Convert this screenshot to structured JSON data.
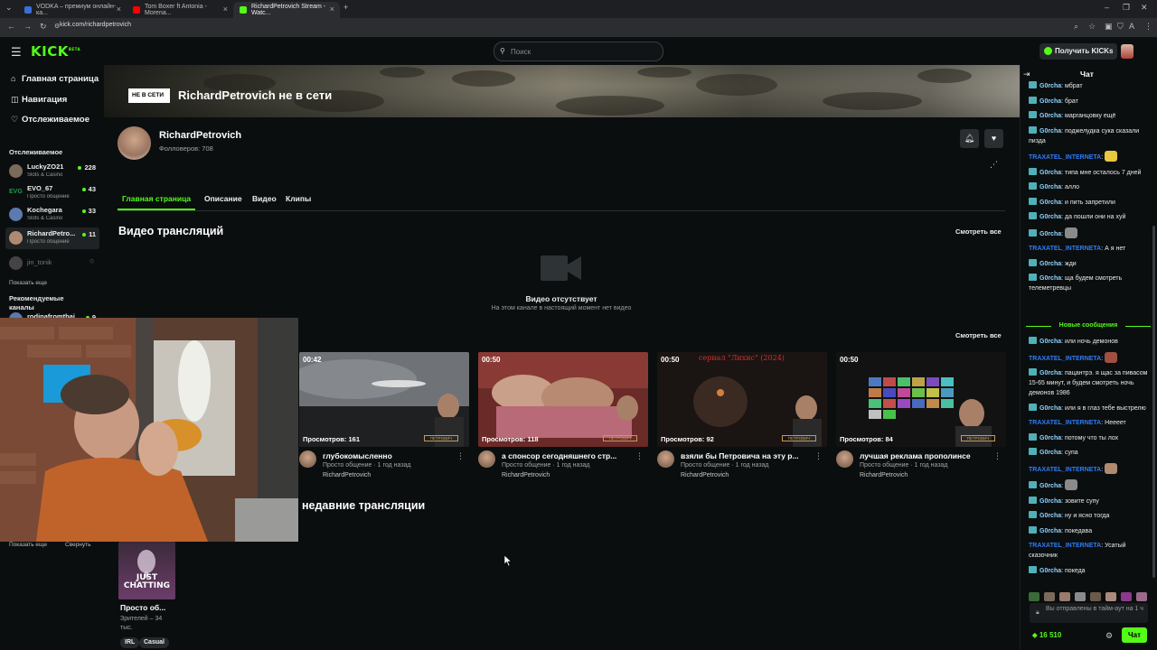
{
  "browser": {
    "tabs": [
      {
        "label": "VODKA – премиум онлайн-ка...",
        "favicon_color": "#3b6fd8"
      },
      {
        "label": "Tom Boxer ft Antonia - Morena...",
        "favicon_color": "#ff0000"
      },
      {
        "label": "RichardPetrovich Stream - Watc...",
        "favicon_color": "#53fc18"
      }
    ],
    "url": "kick.com/richardpetrovich"
  },
  "topnav": {
    "logo": "KICK",
    "logo_beta": "BETA",
    "search_placeholder": "Поиск",
    "get_kicks": "Получить KICKs"
  },
  "sidebar": {
    "nav": [
      {
        "label": "Главная страница",
        "icon": "home-icon"
      },
      {
        "label": "Навигация",
        "icon": "compass-icon"
      },
      {
        "label": "Отслеживаемое",
        "icon": "heart-icon"
      }
    ],
    "following_title": "Отслеживаемое",
    "following": [
      {
        "name": "LuckyZO21",
        "category": "Slots & Casino",
        "viewers": "228",
        "color": "#7a6a5a"
      },
      {
        "name": "EVO_67",
        "category": "Просто общение",
        "viewers": "43",
        "color": "#1c7a3c"
      },
      {
        "name": "Kochegara",
        "category": "Slots & Casino",
        "viewers": "33",
        "color": "#5a7ab0"
      },
      {
        "name": "RichardPetro...",
        "category": "Просто общение",
        "viewers": "11",
        "color": "#b08a70"
      },
      {
        "name": "jin_tonik",
        "category": "",
        "viewers": "",
        "color": "#444"
      }
    ],
    "show_more": "Показать еще",
    "recommended_title": "Рекомендуемые каналы",
    "recommended_first": "rodinafromthai",
    "recommended_count": "9",
    "bottom_show_more": "Показать еще",
    "collapse": "Свернуть"
  },
  "channel": {
    "offline_badge": "НЕ В СЕТИ",
    "offline_title": "RichardPetrovich не в сети",
    "name": "RichardPetrovich",
    "followers": "Фолловеров: 708",
    "tabs": [
      "Главная страница",
      "Описание",
      "Видео",
      "Клипы"
    ],
    "active_tab": 0
  },
  "videos": {
    "title": "Видео трансляций",
    "see_all": "Смотреть все",
    "empty_title": "Видео отсутствует",
    "empty_sub": "На этом канале в настоящий момент нет видео"
  },
  "clips": {
    "see_all": "Смотреть все",
    "items": [
      {
        "duration": "00:42",
        "views": "Просмотров: 161",
        "title": "глубокомысленно",
        "meta": "Просто общение · 1 год назад",
        "author": "RichardPetrovich"
      },
      {
        "duration": "00:50",
        "views": "Просмотров: 118",
        "title": "а спонсор сегодняшнего стр...",
        "meta": "Просто общение · 1 год назад",
        "author": "RichardPetrovich"
      },
      {
        "duration": "00:50",
        "views": "Просмотров: 92",
        "title": "взяли бы Петровича на эту р...",
        "meta": "Просто общение · 1 год назад",
        "author": "RichardPetrovich",
        "overlay_text": "сериал \"Лихис\" (2024)"
      },
      {
        "duration": "00:50",
        "views": "Просмотров: 84",
        "title": "лучшая реклама прополинсе",
        "meta": "Просто общение · 1 год назад",
        "author": "RichardPetrovich"
      }
    ]
  },
  "recent": {
    "title": "недавние трансляции",
    "card_label": "JUST CHATTING",
    "card_title": "Просто об...",
    "card_viewers": "Зрителей – 34 тыс.",
    "tags": [
      "IRL",
      "Casual"
    ]
  },
  "chat": {
    "title": "Чат",
    "new_messages": "Новые сообщения",
    "messages_before": [
      {
        "user": "G0rcha",
        "text": "мбрат",
        "type": "g"
      },
      {
        "user": "G0rcha",
        "text": "брат",
        "type": "g"
      },
      {
        "user": "G0rcha",
        "text": "марганцовку ещё",
        "type": "g"
      },
      {
        "user": "G0rcha",
        "text": "поджелудка сука сказали пизда",
        "type": "g"
      },
      {
        "user": "TRAXATEL_INTERNETA",
        "text": "",
        "type": "t",
        "emote": "#e8c840"
      },
      {
        "user": "G0rcha",
        "text": "типа мне осталось 7 дней",
        "type": "g"
      },
      {
        "user": "G0rcha",
        "text": "алло",
        "type": "g"
      },
      {
        "user": "G0rcha",
        "text": "и пить запретили",
        "type": "g"
      },
      {
        "user": "G0rcha",
        "text": "да пошли они на хуй",
        "type": "g"
      },
      {
        "user": "G0rcha",
        "text": "",
        "type": "g",
        "emote": "#8a8a8a"
      },
      {
        "user": "TRAXATEL_INTERNETA",
        "text": "А я нет",
        "type": "t"
      },
      {
        "user": "G0rcha",
        "text": "жди",
        "type": "g"
      },
      {
        "user": "G0rcha",
        "text": "ща будем смотреть телеметревцы",
        "type": "g"
      }
    ],
    "messages_after": [
      {
        "user": "G0rcha",
        "text": "или ночь демонов",
        "type": "g"
      },
      {
        "user": "TRAXATEL_INTERNETA",
        "text": "",
        "type": "t",
        "emote": "#a05040"
      },
      {
        "user": "G0rcha",
        "text": "пацантрэ. я щас за пивасом 15-65 минут, и будем смотреть ночь демонов 1986",
        "type": "g"
      },
      {
        "user": "G0rcha",
        "text": "или я в глаз тебе выстрелю",
        "type": "g"
      },
      {
        "user": "TRAXATEL_INTERNETA",
        "text": "Нееeет",
        "type": "t"
      },
      {
        "user": "G0rcha",
        "text": "потому что ты лох",
        "type": "g"
      },
      {
        "user": "G0rcha",
        "text": "супа",
        "type": "g"
      },
      {
        "user": "TRAXATEL_INTERNETA",
        "text": "",
        "type": "t",
        "emote": "#b08a70"
      },
      {
        "user": "G0rcha",
        "text": "",
        "type": "g",
        "emote": "#8a8a8a"
      },
      {
        "user": "G0rcha",
        "text": "зовите супу",
        "type": "g"
      },
      {
        "user": "G0rcha",
        "text": "ну и ясно тогда",
        "type": "g"
      },
      {
        "user": "G0rcha",
        "text": "покедава",
        "type": "g"
      },
      {
        "user": "TRAXATEL_INTERNETA",
        "text": "Усатый сказочник",
        "type": "t"
      },
      {
        "user": "G0rcha",
        "text": "покеда",
        "type": "g"
      }
    ],
    "timeout_text": "Вы отправлены в тайм-аут на 1 ч",
    "kicks": "16 510",
    "send": "Чат"
  }
}
